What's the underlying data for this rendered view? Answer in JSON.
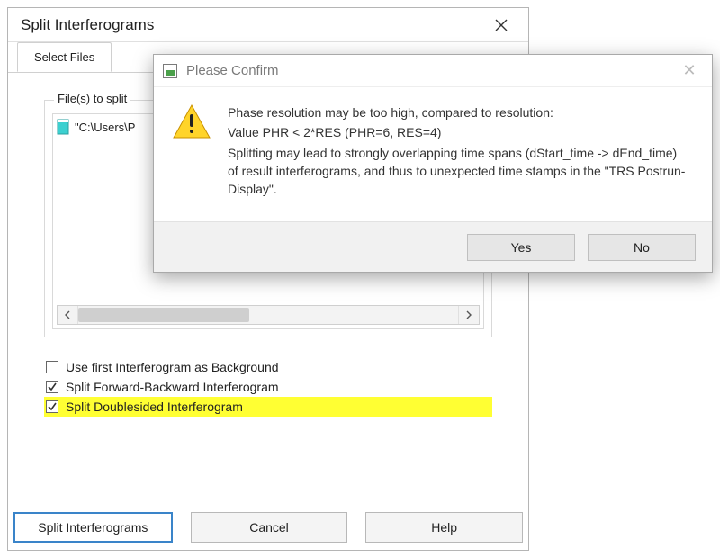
{
  "mainWindow": {
    "title": "Split Interferograms",
    "tab": "Select Files",
    "groupLegend": "File(s) to split",
    "files": [
      "\"C:\\Users\\P"
    ],
    "options": {
      "opt1": {
        "label": "Use first Interferogram as Background",
        "checked": false
      },
      "opt2": {
        "label": "Split Forward-Backward Interferogram",
        "checked": true
      },
      "opt3": {
        "label": "Split Doublesided Interferogram",
        "checked": true
      }
    },
    "buttons": {
      "primary": "Split Interferograms",
      "cancel": "Cancel",
      "help": "Help"
    }
  },
  "dialog": {
    "title": "Please Confirm",
    "line1": "Phase resolution may be too high, compared to resolution:",
    "line2": "Value PHR < 2*RES (PHR=6, RES=4)",
    "line3": "Splitting may lead to strongly overlapping time spans (dStart_time -> dEnd_time) of result interferograms, and thus to unexpected time stamps in the \"TRS Postrun-Display\".",
    "yes": "Yes",
    "no": "No"
  }
}
